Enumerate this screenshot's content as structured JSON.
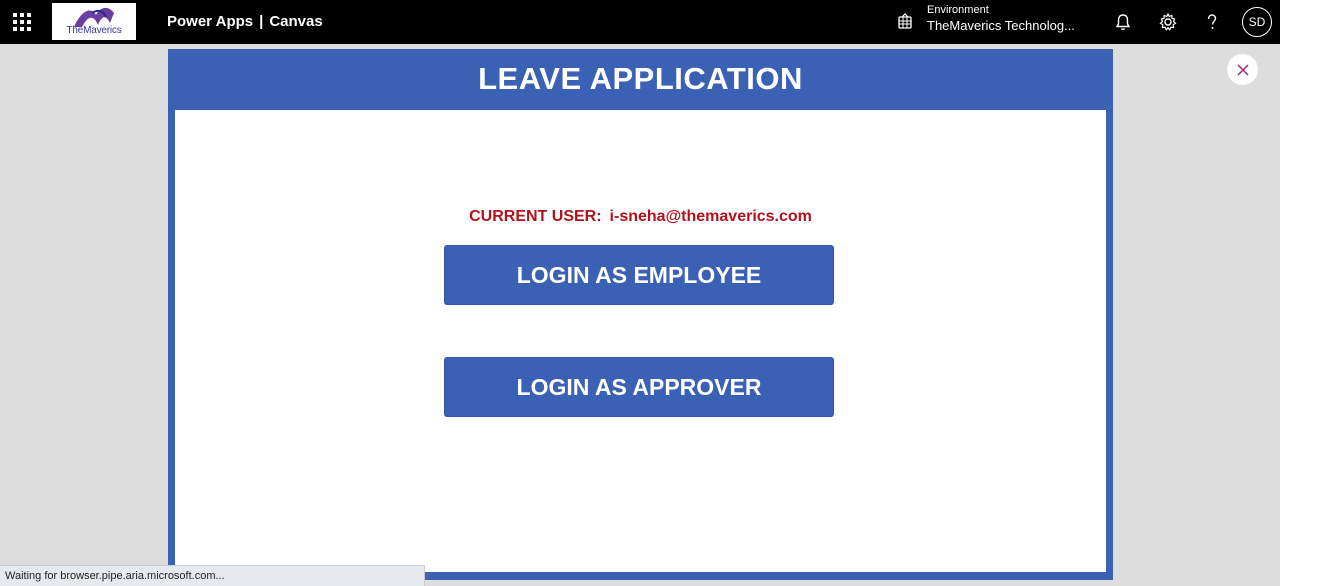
{
  "topbar": {
    "logo_text": "TheMaverics",
    "product": "Power Apps",
    "separator": "|",
    "section": "Canvas",
    "environment_label": "Environment",
    "environment_name": "TheMaverics Technolog...",
    "avatar_initials": "SD",
    "icons": [
      "waffle-icon",
      "environment-icon",
      "bell-icon",
      "gear-icon",
      "help-icon"
    ]
  },
  "app": {
    "title": "LEAVE APPLICATION",
    "current_user_label": "CURRENT USER:",
    "current_user_email": "i-sneha@themaverics.com",
    "buttons": {
      "employee": "LOGIN AS EMPLOYEE",
      "approver": "LOGIN AS APPROVER"
    }
  },
  "status_bar": {
    "text": "Waiting for browser.pipe.aria.microsoft.com..."
  },
  "colors": {
    "accent_blue": "#3a61b3",
    "user_red": "#b3121b",
    "stage_gray": "#dddddd",
    "topbar_black": "#000000"
  }
}
